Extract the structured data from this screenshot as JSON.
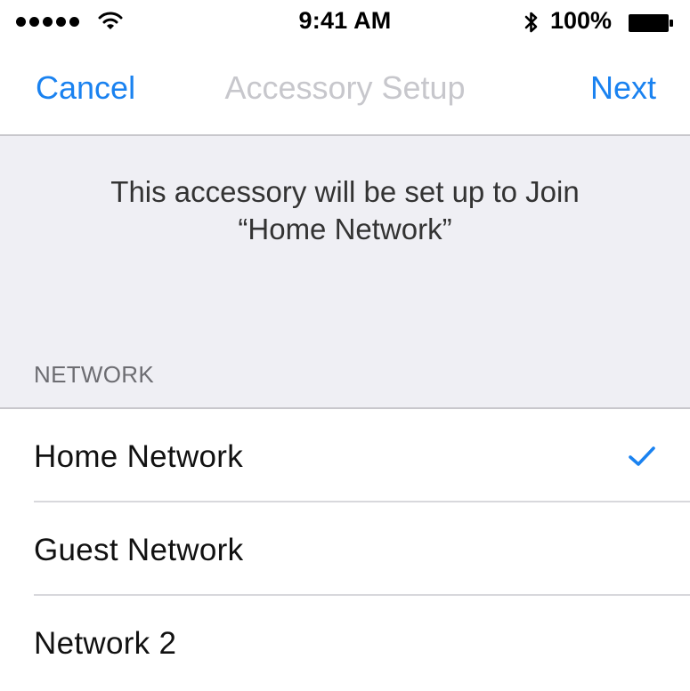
{
  "status_bar": {
    "time": "9:41 AM",
    "battery_percent": "100%",
    "signal_bars": 5
  },
  "nav": {
    "cancel_label": "Cancel",
    "title": "Accessory Setup",
    "next_label": "Next"
  },
  "info": {
    "line1": "This accessory will be set up to Join",
    "line2": "“Home Network”"
  },
  "section": {
    "header": "NETWORK"
  },
  "networks": [
    {
      "label": "Home Network",
      "selected": true
    },
    {
      "label": "Guest Network",
      "selected": false
    },
    {
      "label": "Network 2",
      "selected": false
    }
  ],
  "colors": {
    "accent": "#1a82f0",
    "disabled_title": "#c7c7cc",
    "grouped_background": "#efeff4",
    "separator": "#c8c7cc"
  },
  "icons": {
    "signal": "signal-dots-icon",
    "wifi": "wifi-icon",
    "bluetooth": "bluetooth-icon",
    "battery": "battery-icon",
    "check": "checkmark-icon"
  }
}
